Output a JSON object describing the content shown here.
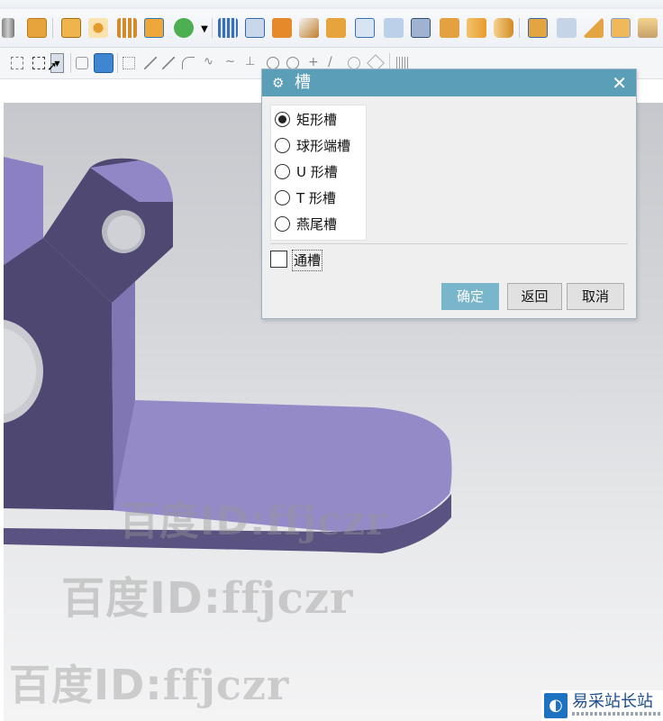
{
  "dialog": {
    "title": "槽",
    "options": [
      {
        "label": "矩形槽",
        "selected": true
      },
      {
        "label": "球形端槽",
        "selected": false
      },
      {
        "label": "U 形槽",
        "selected": false
      },
      {
        "label": "T 形槽",
        "selected": false
      },
      {
        "label": "燕尾槽",
        "selected": false
      }
    ],
    "through_slot_label": "通槽",
    "through_slot_checked": false,
    "buttons": {
      "ok": "确定",
      "back": "返回",
      "cancel": "取消"
    },
    "title_bar_color": "#5b9eb8",
    "ok_button_color": "#79b5cb"
  },
  "watermarks": [
    {
      "prefix": "百度ID:",
      "text": "ffjczr"
    },
    {
      "prefix": "百度ID:",
      "text": "ffjczr"
    },
    {
      "prefix": "百度ID:",
      "text": "ffjczr"
    }
  ],
  "logo": {
    "text": "易采站长站"
  },
  "model": {
    "color": "#8f84c6",
    "shadow_color": "#4f4873"
  },
  "icons": {
    "gear": "gear-icon",
    "close": "close-icon",
    "dropdown": "chevron-down-icon"
  }
}
